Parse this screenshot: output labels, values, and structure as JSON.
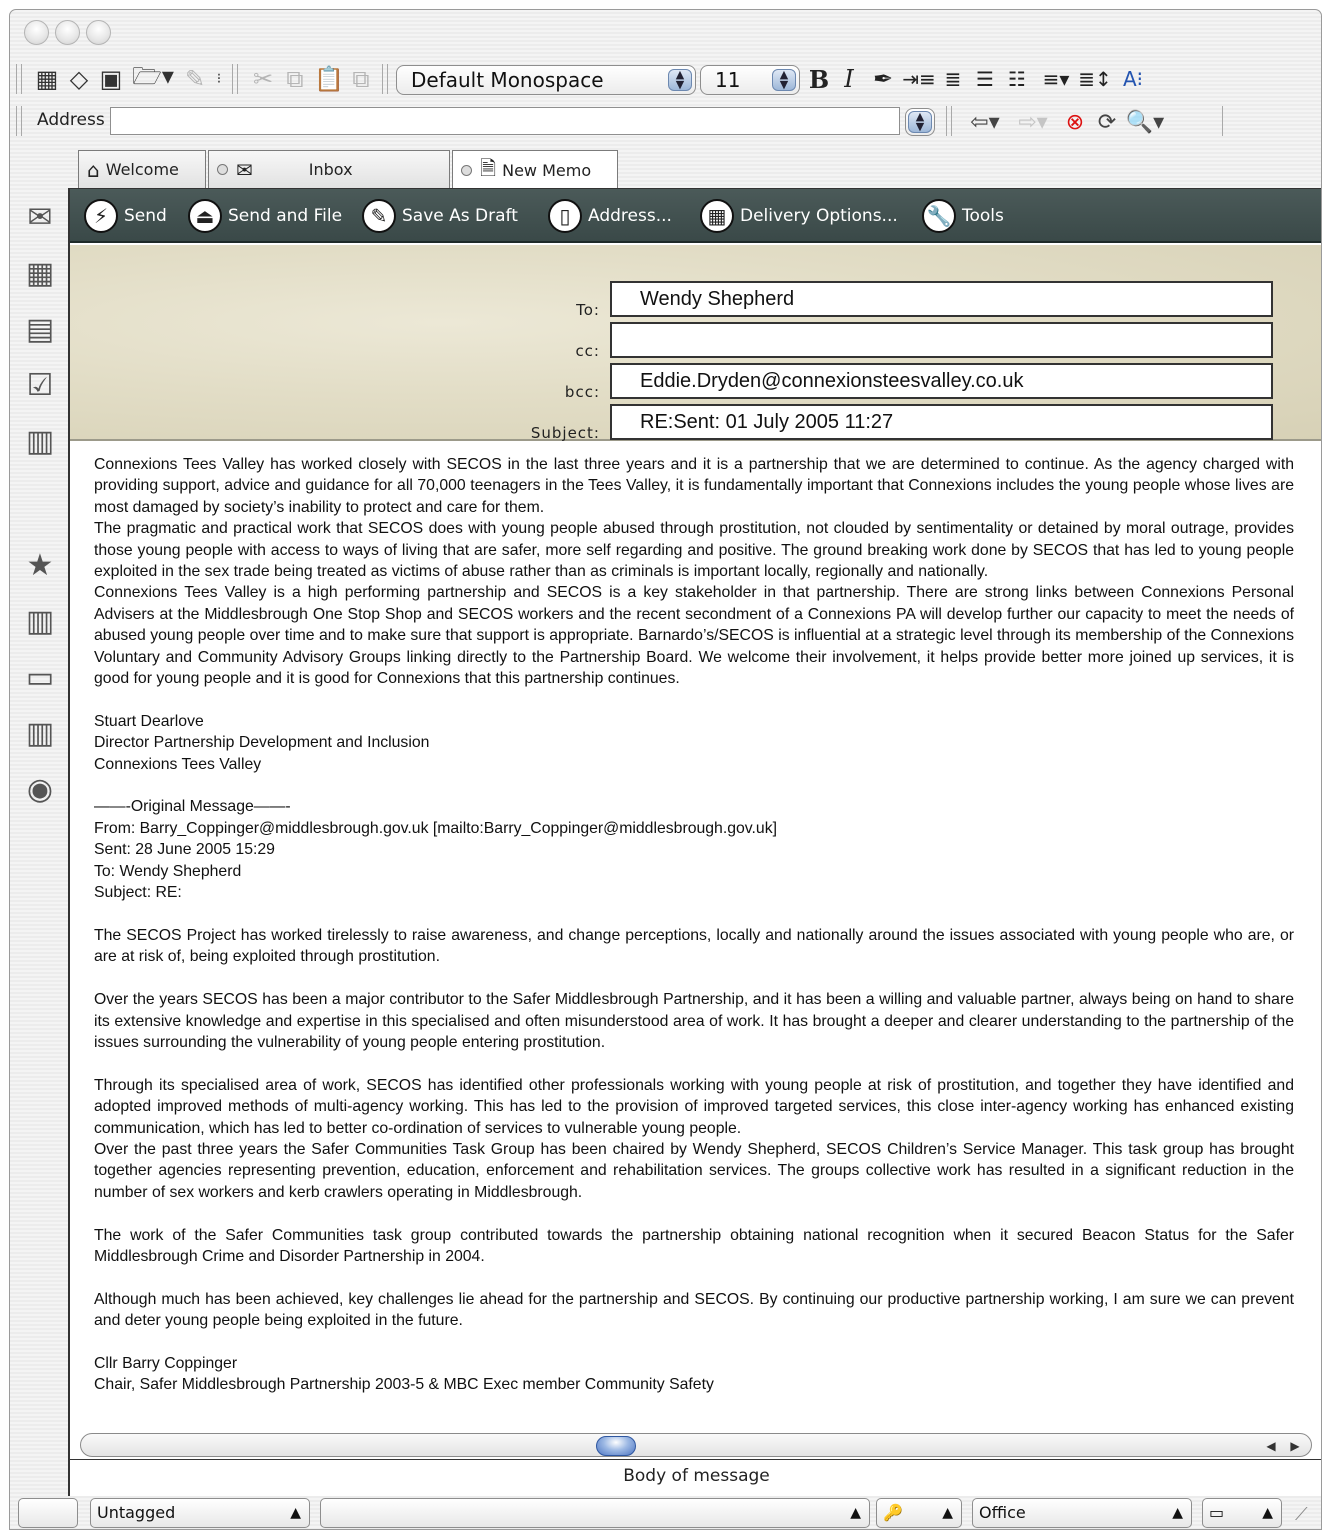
{
  "toolbar": {
    "font_name": "Default Monospace",
    "font_size": "11",
    "bold_label": "B",
    "italic_label": "I"
  },
  "address_bar": {
    "label": "Address",
    "value": ""
  },
  "tabs": [
    {
      "label": "Welcome",
      "icon": "house-icon"
    },
    {
      "label": "Inbox",
      "icon": "inbox-icon"
    },
    {
      "label": "New Memo",
      "icon": "memo-icon"
    }
  ],
  "actions": [
    {
      "label": "Send",
      "icon": "send-icon"
    },
    {
      "label": "Send and File",
      "icon": "send-and-file-icon"
    },
    {
      "label": "Save As Draft",
      "icon": "save-draft-icon"
    },
    {
      "label": "Address...",
      "icon": "address-book-icon"
    },
    {
      "label": "Delivery Options...",
      "icon": "delivery-options-icon"
    },
    {
      "label": "Tools",
      "icon": "tools-icon"
    }
  ],
  "header": {
    "to_label": "To:",
    "cc_label": "cc:",
    "bcc_label": "bcc:",
    "subject_label": "Subject:",
    "to": "Wendy Shepherd",
    "cc": "",
    "bcc": "Eddie.Dryden@connexionsteesvalley.co.uk",
    "subject": "RE:Sent: 01 July 2005 11:27"
  },
  "body": {
    "p1": "Connexions Tees Valley has worked closely with SECOS in the last three years and it is a partnership that we are determined to continue. As the agency charged with providing support, advice and guidance for all 70,000 teenagers in the Tees Valley, it is fundamentally important that Connexions includes the young people whose lives are most damaged by society’s inability to protect and care for them.",
    "p2": "The pragmatic and practical work that SECOS does with young people abused through prostitution, not clouded by sentimentality or detained by moral outrage, provides those young people with access to ways of living that are safer, more self regarding and positive. The ground breaking work done by SECOS that has led to young people exploited in the sex trade being treated as victims of abuse rather than as criminals is important locally, regionally and nationally.",
    "p3": "Connexions Tees Valley is a high performing partnership and SECOS is a key stakeholder in that partnership. There are strong links between Connexions Personal Advisers at the Middlesbrough One Stop Shop and SECOS workers and the recent secondment of a Connexions PA will develop further our capacity to meet the needs of abused young people over time and to make sure that support is appropriate. Barnardo’s/SECOS is influential at a strategic level through its membership of the Connexions Voluntary and Community Advisory Groups linking directly to the Partnership Board. We welcome their involvement, it helps provide better more joined up services, it is good for young people and it is good for Connexions that this partnership continues.",
    "sig1_name": "Stuart Dearlove",
    "sig1_title": "Director Partnership Development and Inclusion",
    "sig1_org": "Connexions Tees Valley",
    "orig_header": "——-Original Message——-",
    "orig_from": "From: Barry_Coppinger@middlesbrough.gov.uk [mailto:Barry_Coppinger@middlesbrough.gov.uk]",
    "orig_sent": "Sent: 28 June 2005 15:29",
    "orig_to": "To: Wendy Shepherd",
    "orig_subject": "Subject: RE:",
    "p4": "The SECOS Project has worked tirelessly to raise awareness, and change perceptions, locally and nationally around the issues associated with young people who are, or are at risk of, being exploited through prostitution.",
    "p5": "Over the years SECOS has been a major contributor to the Safer Middlesbrough Partnership, and it has been a willing and valuable partner, always being on hand to share its extensive knowledge and expertise in this specialised and often misunderstood area of work. It has brought a deeper and clearer understanding to the partnership of the issues surrounding the vulnerability of young people entering prostitution.",
    "p6": "Through its specialised area of work, SECOS has identified other professionals working with young people at risk of prostitution, and together they have identified and adopted improved methods of multi-agency working. This has led to the provision of improved targeted services, this close inter-agency working has enhanced existing communication, which has led to better co-ordination of services to vulnerable young people.",
    "p7": "Over the past three years the Safer Communities Task Group has been chaired by Wendy Shepherd, SECOS Children’s Service Manager. This task group has brought together agencies representing prevention, education, enforcement and rehabilitation services. The groups collective work has resulted in a significant reduction in the number of sex workers and kerb crawlers operating in Middlesbrough.",
    "p8": "The work of the Safer Communities task group contributed towards the partnership obtaining national recognition when it secured Beacon Status for the Safer Middlesbrough Crime and Disorder Partnership in 2004.",
    "p9": "Although much has been achieved, key challenges lie ahead for the partnership and SECOS. By continuing our productive partnership working, I am sure we can prevent and deter young people being exploited in the future.",
    "sig2_name": "Cllr Barry Coppinger",
    "sig2_title": "Chair, Safer Middlesbrough Partnership 2003-5 & MBC Exec member Community Safety"
  },
  "status": {
    "field_label": "Body of message"
  },
  "bottom": {
    "tag": "Untagged",
    "middle": "",
    "location": "Office"
  }
}
